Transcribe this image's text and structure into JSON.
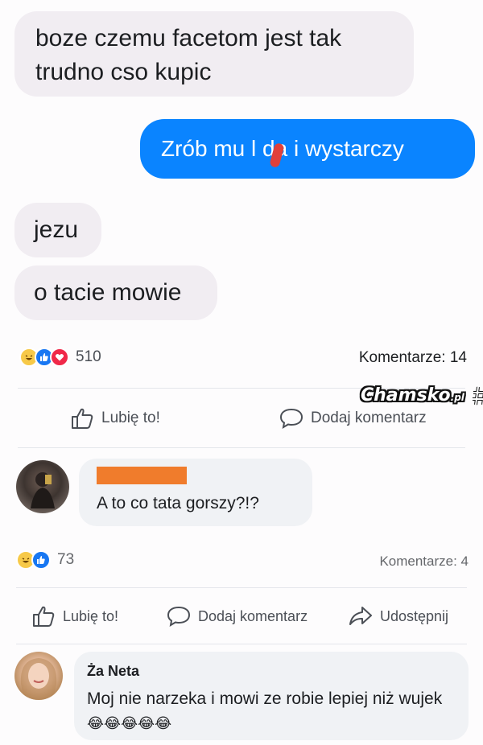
{
  "messages": {
    "incoming_1": "boze czemu facetom jest tak trudno cso kupic",
    "outgoing_1": "Zrób mu l da i wystarczy",
    "incoming_2": "jezu",
    "incoming_3": "o tacie mowie"
  },
  "post": {
    "reactions_count": "510",
    "comments_label": "Komentarze: 14",
    "like_label": "Lubię to!",
    "comment_label": "Dodaj komentarz"
  },
  "watermark": {
    "text": "Chamsko",
    "suffix": ".pl"
  },
  "comment_1": {
    "author_redacted": true,
    "text": "A to co tata gorszy?!?",
    "reactions_count": "73",
    "comments_label": "Komentarze: 4",
    "like_label": "Lubię to!",
    "comment_label": "Dodaj komentarz",
    "share_label": "Udostępnij"
  },
  "comment_2": {
    "author": "Ża Neta",
    "text": "Moj nie narzeka i mowi ze robie lepiej niż wujek",
    "emoji": "😂😂😂😂😂"
  },
  "colors": {
    "outgoing_bubble": "#0a84ff",
    "incoming_bubble": "#f1edf2",
    "redaction": "#f07c2c",
    "like_blue": "#1877f2",
    "love_red": "#f02849",
    "haha_yellow": "#f7c948"
  },
  "icons": [
    "haha-icon",
    "like-icon",
    "love-icon",
    "thumbs-up-icon",
    "comment-icon",
    "share-icon"
  ]
}
